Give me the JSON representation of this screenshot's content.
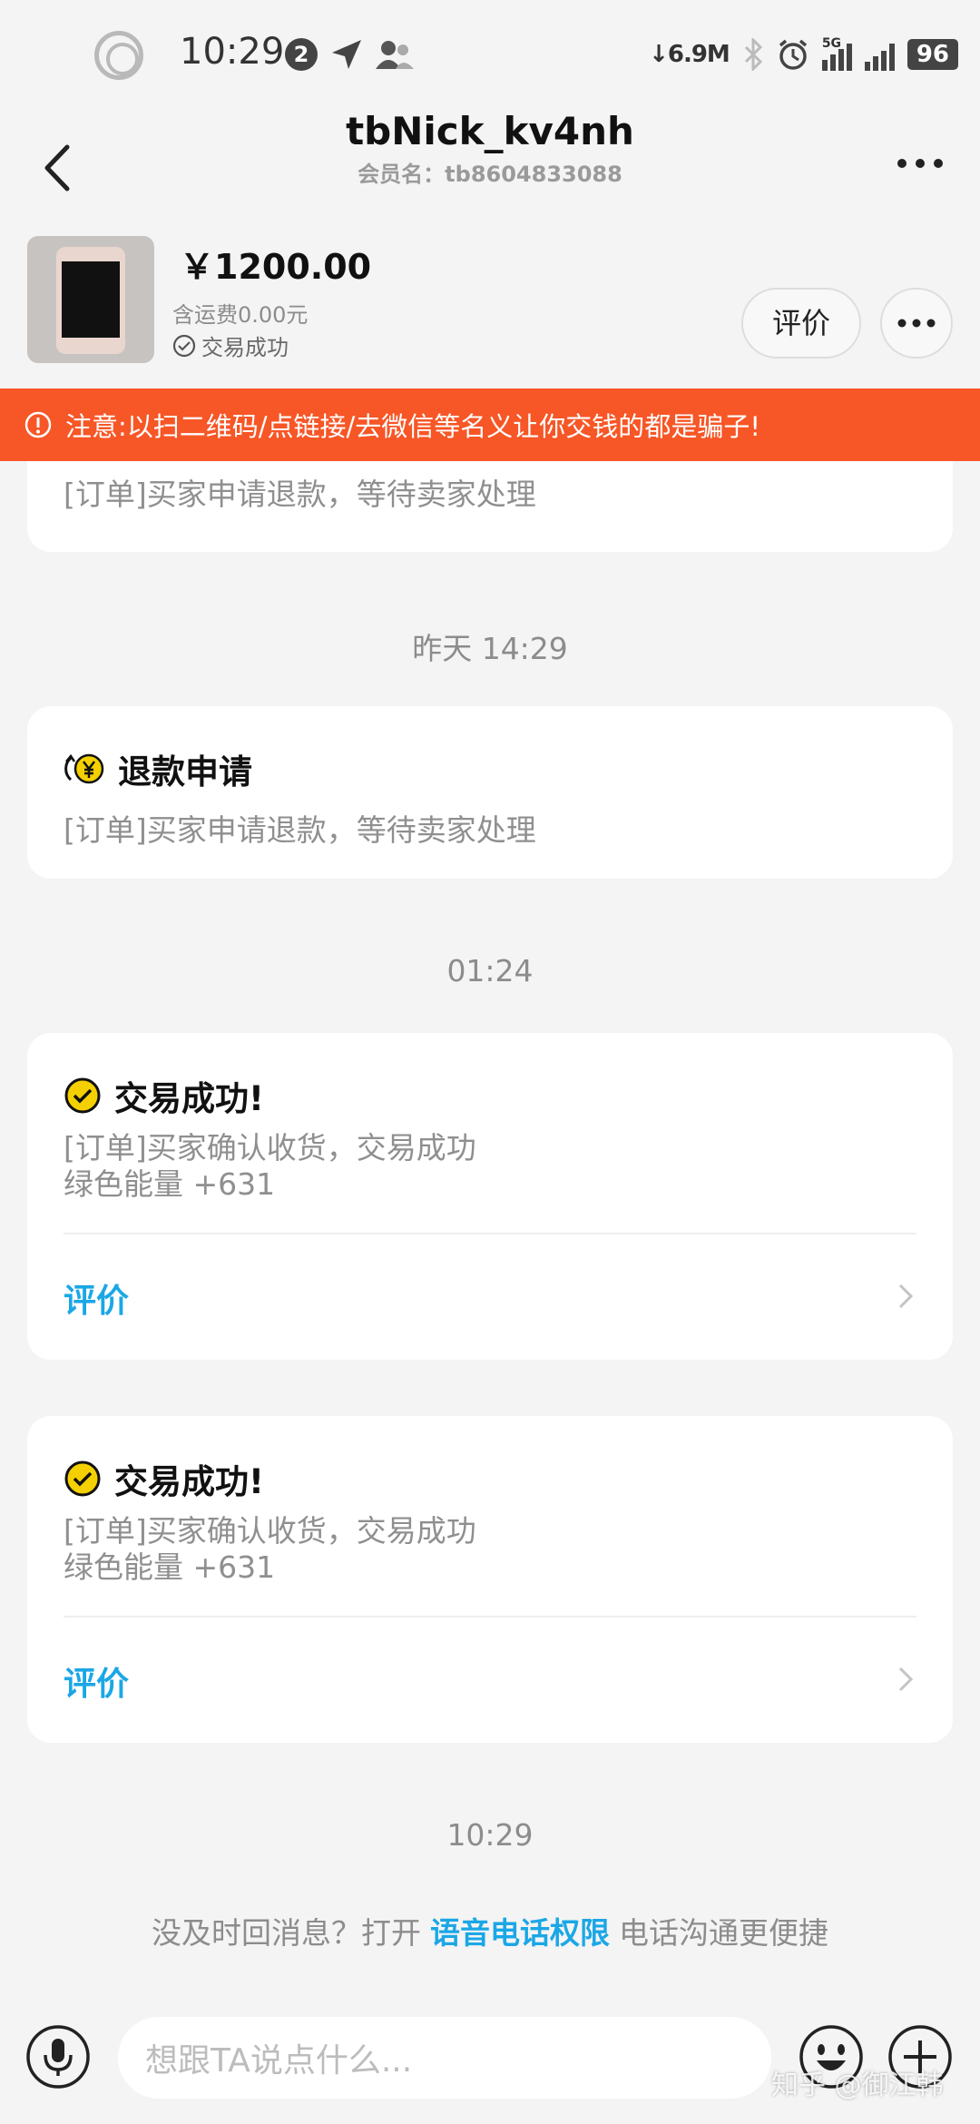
{
  "status_bar": {
    "time": "10:29",
    "notification_count": "2",
    "net_speed": "6.9M",
    "network": "5G",
    "battery": "96"
  },
  "header": {
    "title": "tbNick_kv4nh",
    "subtitle": "会员名：tb8604833088"
  },
  "product": {
    "price": "￥1200.00",
    "shipping": "含运费0.00元",
    "status": "交易成功",
    "review_button": "评价"
  },
  "warning": {
    "text": "注意:以扫二维码/点链接/去微信等名义让你交钱的都是骗子!"
  },
  "messages": {
    "partial_card": {
      "line1": "[订单]买家申请退款，等待卖家处理"
    },
    "time1": "昨天 14:29",
    "refund_card": {
      "title": "退款申请",
      "line1": "[订单]买家申请退款，等待卖家处理"
    },
    "time2": "01:24",
    "success_card_1": {
      "title": "交易成功!",
      "line1": "[订单]买家确认收货，交易成功",
      "line2": "绿色能量 +631",
      "action": "评价"
    },
    "success_card_2": {
      "title": "交易成功!",
      "line1": "[订单]买家确认收货，交易成功",
      "line2": "绿色能量 +631",
      "action": "评价"
    },
    "time3": "10:29"
  },
  "hint": {
    "prefix": "没及时回消息？打开",
    "link": "语音电话权限",
    "suffix": "电话沟通更便捷"
  },
  "input": {
    "placeholder": "想跟TA说点什么..."
  },
  "watermark": "知乎 @御江韩",
  "colors": {
    "warning_bg": "#f75626",
    "link_blue": "#1ba7e6",
    "success_yellow": "#f5d000"
  }
}
